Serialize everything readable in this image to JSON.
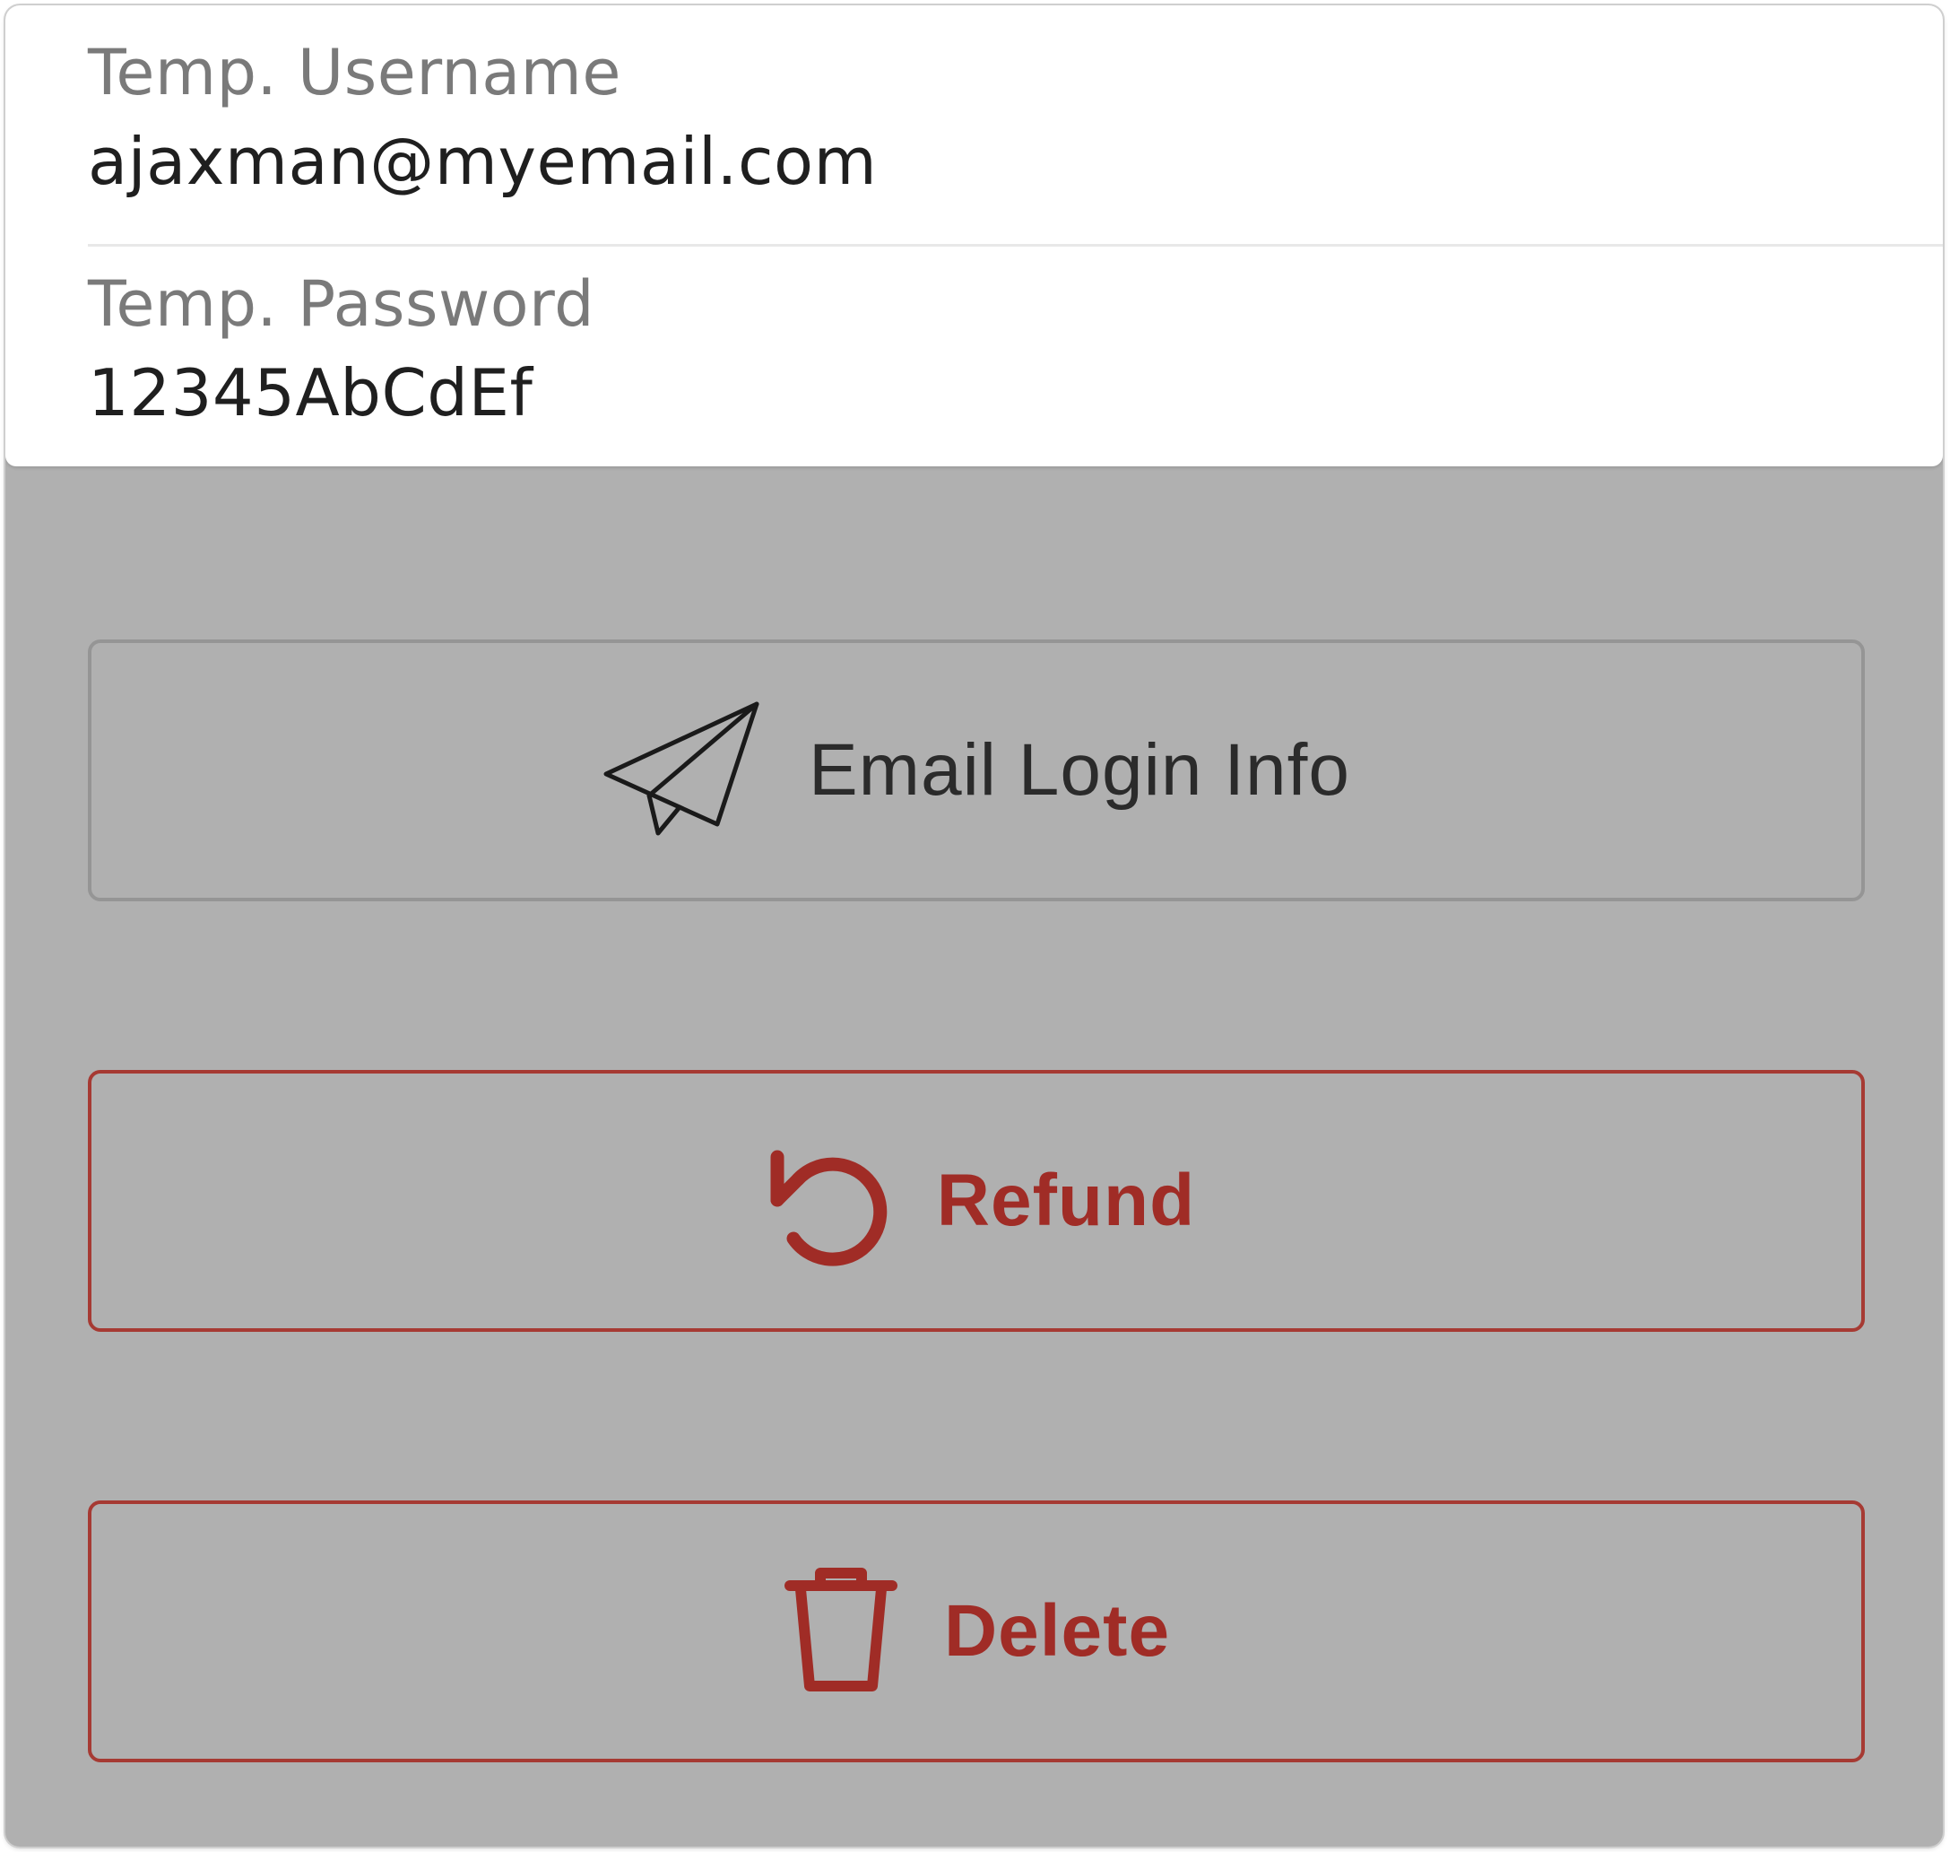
{
  "credentials": {
    "username": {
      "label": "Temp. Username",
      "value": "ajaxman@myemail.com"
    },
    "password": {
      "label": "Temp. Password",
      "value": "12345AbCdEf"
    }
  },
  "actions": {
    "email": {
      "label": "Email Login Info",
      "icon": "paper-plane-icon"
    },
    "refund": {
      "label": "Refund",
      "icon": "undo-icon"
    },
    "delete": {
      "label": "Delete",
      "icon": "trash-icon"
    }
  },
  "colors": {
    "background": "#b0b0b0",
    "card": "#ffffff",
    "danger": "#a02c26",
    "neutral_border": "#959595"
  }
}
